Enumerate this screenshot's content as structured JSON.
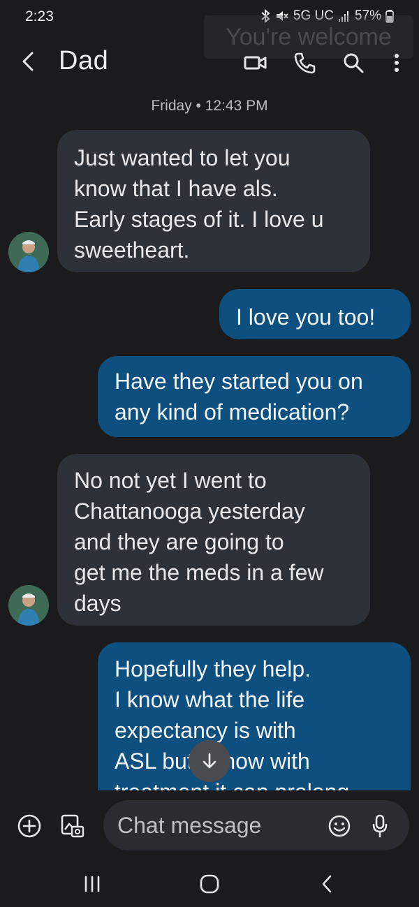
{
  "status_bar": {
    "time": "2:23",
    "network": "5G UC",
    "battery": "57%"
  },
  "overlay_text": "You're welcome",
  "header": {
    "contact_name": "Dad",
    "icons": [
      "back-icon",
      "video-call-icon",
      "phone-icon",
      "search-icon",
      "more-vert-icon"
    ]
  },
  "conversation": {
    "date_separator": "Friday • 12:43 PM",
    "messages": [
      {
        "direction": "incoming",
        "lines": [
          "Just wanted to let you",
          "know that I have als.",
          "Early stages of it. I love u",
          "sweetheart."
        ]
      },
      {
        "direction": "outgoing",
        "lines": [
          "I love you too!"
        ]
      },
      {
        "direction": "outgoing",
        "lines": [
          "Have they started you on",
          "any kind of medication?"
        ]
      },
      {
        "direction": "incoming",
        "lines": [
          "No not yet I went to",
          "Chattanooga yesterday",
          "and they are going to",
          "get me the meds in a few",
          "days"
        ]
      },
      {
        "direction": "outgoing",
        "lines": [
          "Hopefully they help.",
          "I know what the life",
          "expectancy is with",
          "ASL but I know with",
          "treatment it can prolong"
        ]
      }
    ]
  },
  "composer": {
    "placeholder": "Chat message",
    "icons": [
      "add-icon",
      "gallery-icon",
      "emoji-icon",
      "mic-icon"
    ]
  },
  "nav_bar": {
    "icons": [
      "recents-icon",
      "home-icon",
      "back-nav-icon"
    ]
  },
  "colors": {
    "background": "#1b1b1d",
    "incoming_bubble": "#2d3139",
    "outgoing_bubble": "#0d4f7e"
  }
}
